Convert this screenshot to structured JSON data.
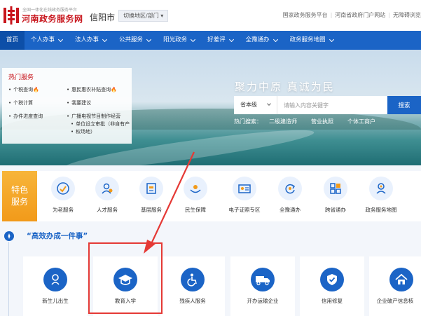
{
  "header": {
    "logo_sub": "全国一体化在线政务服务平台",
    "logo_main": "河南政务服务网",
    "city": "信阳市",
    "switch_label": "切换地区/部门 ▾",
    "links": [
      "国家政务服务平台",
      "河南省政府门户网站",
      "无障碍浏览"
    ]
  },
  "nav": {
    "items": [
      {
        "label": "首页"
      },
      {
        "label": "个人办事"
      },
      {
        "label": "法人办事"
      },
      {
        "label": "公共服务"
      },
      {
        "label": "阳光政务"
      },
      {
        "label": "好差评"
      },
      {
        "label": "全豫通办"
      },
      {
        "label": "政务服务地图"
      }
    ]
  },
  "banner": {
    "slogan": "聚力中原 真诚为民",
    "search": {
      "scope": "省本级",
      "placeholder": "请输入内容关键字",
      "button": "搜索"
    },
    "hot_label": "热门搜索：",
    "hot_terms": [
      "二级建造师",
      "营业执照",
      "个体工商户"
    ]
  },
  "hot_services": {
    "title": "热门服务",
    "items": [
      {
        "label": "个税查询",
        "hot": "🔥"
      },
      {
        "label": "惠民惠农补贴查询",
        "hot": "🔥"
      },
      {
        "label": "个税计算"
      },
      {
        "label": "我要建议"
      },
      {
        "label": "办件进度查询"
      },
      {
        "label": "广播电视节目制作经营"
      },
      {
        "label": "单位设立审批（非自有产"
      },
      {
        "label": "权场地）"
      }
    ]
  },
  "featured": {
    "tag_line1": "特色",
    "tag_line2": "服务",
    "items": [
      {
        "label": "为老服务"
      },
      {
        "label": "人才服务"
      },
      {
        "label": "基层服务"
      },
      {
        "label": "民生保障"
      },
      {
        "label": "电子证照专区"
      },
      {
        "label": "全豫通办"
      },
      {
        "label": "跨省通办"
      },
      {
        "label": "政务服务地图"
      }
    ]
  },
  "one_thing": {
    "title": "“高效办成一件事”",
    "cards": [
      {
        "label": "新生儿出生"
      },
      {
        "label": "教育入学"
      },
      {
        "label": "残疾人服务"
      },
      {
        "label": "开办运输企业"
      },
      {
        "label": "信用修复"
      },
      {
        "label": "企业破产信息核"
      }
    ]
  },
  "colors": {
    "brand_red": "#c8161d",
    "nav_blue": "#1b64c6",
    "feature_orange": "#f29a1a",
    "annotation_red": "#e53935"
  }
}
